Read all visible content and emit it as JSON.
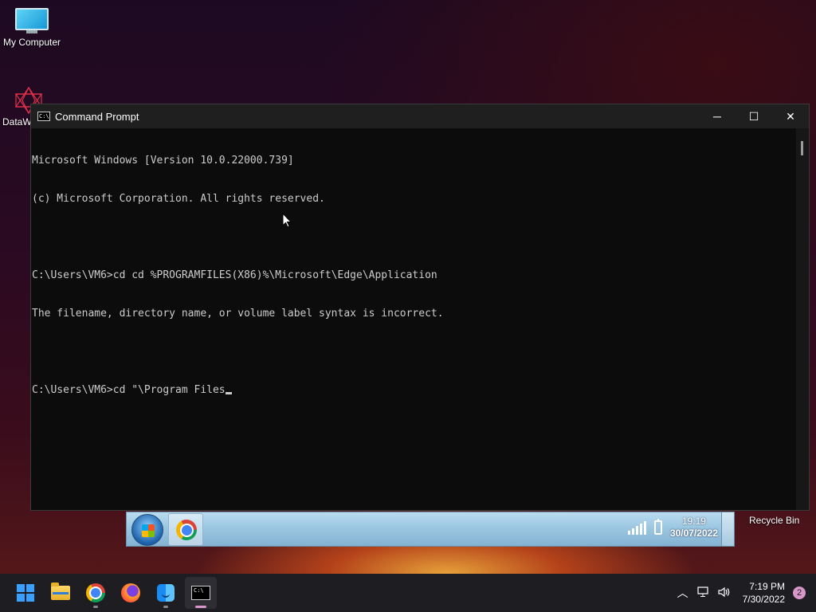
{
  "desktop": {
    "icons": [
      {
        "label": "My Computer"
      },
      {
        "label": "DataW"
      }
    ],
    "recycle_label": "Recycle Bin"
  },
  "window": {
    "title": "Command Prompt",
    "minimize": "─",
    "maximize": "☐",
    "close": "✕",
    "lines": [
      "Microsoft Windows [Version 10.0.22000.739]",
      "(c) Microsoft Corporation. All rights reserved.",
      "",
      "C:\\Users\\VM6>cd cd %PROGRAMFILES(X86)%\\Microsoft\\Edge\\Application",
      "The filename, directory name, or volume label syntax is incorrect.",
      "",
      "C:\\Users\\VM6>cd \"\\Program Files"
    ]
  },
  "inner_taskbar": {
    "time": "19:19",
    "date": "30/07/2022"
  },
  "taskbar": {
    "apps": [
      "start-icon",
      "file-explorer-icon",
      "chrome-icon",
      "firefox-icon",
      "finder-icon",
      "terminal-icon"
    ],
    "clock_time": "7:19 PM",
    "clock_date": "7/30/2022",
    "notification_count": "2",
    "colors": {
      "accent": "#d896c9",
      "taskbar_bg": "#1e1e22"
    }
  }
}
